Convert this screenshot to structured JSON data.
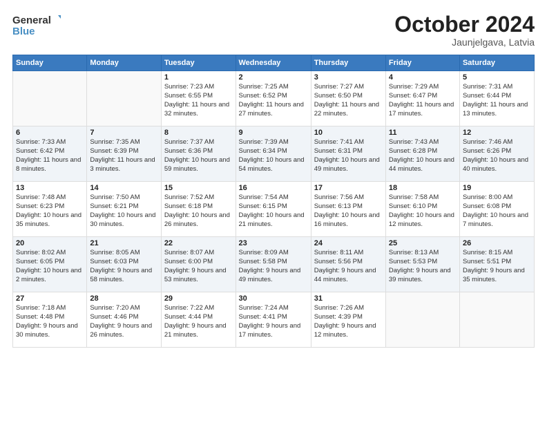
{
  "header": {
    "logo_line1": "General",
    "logo_line2": "Blue",
    "month": "October 2024",
    "location": "Jaunjelgava, Latvia"
  },
  "weekdays": [
    "Sunday",
    "Monday",
    "Tuesday",
    "Wednesday",
    "Thursday",
    "Friday",
    "Saturday"
  ],
  "weeks": [
    [
      {
        "day": "",
        "info": ""
      },
      {
        "day": "",
        "info": ""
      },
      {
        "day": "1",
        "info": "Sunrise: 7:23 AM\nSunset: 6:55 PM\nDaylight: 11 hours and 32 minutes."
      },
      {
        "day": "2",
        "info": "Sunrise: 7:25 AM\nSunset: 6:52 PM\nDaylight: 11 hours and 27 minutes."
      },
      {
        "day": "3",
        "info": "Sunrise: 7:27 AM\nSunset: 6:50 PM\nDaylight: 11 hours and 22 minutes."
      },
      {
        "day": "4",
        "info": "Sunrise: 7:29 AM\nSunset: 6:47 PM\nDaylight: 11 hours and 17 minutes."
      },
      {
        "day": "5",
        "info": "Sunrise: 7:31 AM\nSunset: 6:44 PM\nDaylight: 11 hours and 13 minutes."
      }
    ],
    [
      {
        "day": "6",
        "info": "Sunrise: 7:33 AM\nSunset: 6:42 PM\nDaylight: 11 hours and 8 minutes."
      },
      {
        "day": "7",
        "info": "Sunrise: 7:35 AM\nSunset: 6:39 PM\nDaylight: 11 hours and 3 minutes."
      },
      {
        "day": "8",
        "info": "Sunrise: 7:37 AM\nSunset: 6:36 PM\nDaylight: 10 hours and 59 minutes."
      },
      {
        "day": "9",
        "info": "Sunrise: 7:39 AM\nSunset: 6:34 PM\nDaylight: 10 hours and 54 minutes."
      },
      {
        "day": "10",
        "info": "Sunrise: 7:41 AM\nSunset: 6:31 PM\nDaylight: 10 hours and 49 minutes."
      },
      {
        "day": "11",
        "info": "Sunrise: 7:43 AM\nSunset: 6:28 PM\nDaylight: 10 hours and 44 minutes."
      },
      {
        "day": "12",
        "info": "Sunrise: 7:46 AM\nSunset: 6:26 PM\nDaylight: 10 hours and 40 minutes."
      }
    ],
    [
      {
        "day": "13",
        "info": "Sunrise: 7:48 AM\nSunset: 6:23 PM\nDaylight: 10 hours and 35 minutes."
      },
      {
        "day": "14",
        "info": "Sunrise: 7:50 AM\nSunset: 6:21 PM\nDaylight: 10 hours and 30 minutes."
      },
      {
        "day": "15",
        "info": "Sunrise: 7:52 AM\nSunset: 6:18 PM\nDaylight: 10 hours and 26 minutes."
      },
      {
        "day": "16",
        "info": "Sunrise: 7:54 AM\nSunset: 6:15 PM\nDaylight: 10 hours and 21 minutes."
      },
      {
        "day": "17",
        "info": "Sunrise: 7:56 AM\nSunset: 6:13 PM\nDaylight: 10 hours and 16 minutes."
      },
      {
        "day": "18",
        "info": "Sunrise: 7:58 AM\nSunset: 6:10 PM\nDaylight: 10 hours and 12 minutes."
      },
      {
        "day": "19",
        "info": "Sunrise: 8:00 AM\nSunset: 6:08 PM\nDaylight: 10 hours and 7 minutes."
      }
    ],
    [
      {
        "day": "20",
        "info": "Sunrise: 8:02 AM\nSunset: 6:05 PM\nDaylight: 10 hours and 2 minutes."
      },
      {
        "day": "21",
        "info": "Sunrise: 8:05 AM\nSunset: 6:03 PM\nDaylight: 9 hours and 58 minutes."
      },
      {
        "day": "22",
        "info": "Sunrise: 8:07 AM\nSunset: 6:00 PM\nDaylight: 9 hours and 53 minutes."
      },
      {
        "day": "23",
        "info": "Sunrise: 8:09 AM\nSunset: 5:58 PM\nDaylight: 9 hours and 49 minutes."
      },
      {
        "day": "24",
        "info": "Sunrise: 8:11 AM\nSunset: 5:56 PM\nDaylight: 9 hours and 44 minutes."
      },
      {
        "day": "25",
        "info": "Sunrise: 8:13 AM\nSunset: 5:53 PM\nDaylight: 9 hours and 39 minutes."
      },
      {
        "day": "26",
        "info": "Sunrise: 8:15 AM\nSunset: 5:51 PM\nDaylight: 9 hours and 35 minutes."
      }
    ],
    [
      {
        "day": "27",
        "info": "Sunrise: 7:18 AM\nSunset: 4:48 PM\nDaylight: 9 hours and 30 minutes."
      },
      {
        "day": "28",
        "info": "Sunrise: 7:20 AM\nSunset: 4:46 PM\nDaylight: 9 hours and 26 minutes."
      },
      {
        "day": "29",
        "info": "Sunrise: 7:22 AM\nSunset: 4:44 PM\nDaylight: 9 hours and 21 minutes."
      },
      {
        "day": "30",
        "info": "Sunrise: 7:24 AM\nSunset: 4:41 PM\nDaylight: 9 hours and 17 minutes."
      },
      {
        "day": "31",
        "info": "Sunrise: 7:26 AM\nSunset: 4:39 PM\nDaylight: 9 hours and 12 minutes."
      },
      {
        "day": "",
        "info": ""
      },
      {
        "day": "",
        "info": ""
      }
    ]
  ]
}
